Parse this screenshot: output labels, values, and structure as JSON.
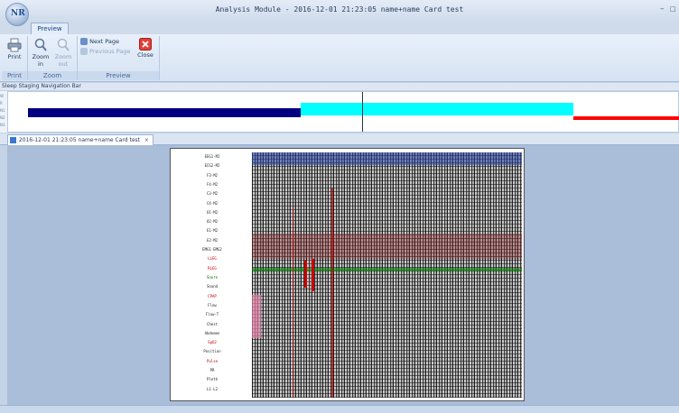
{
  "window": {
    "title": "Analysis Module - 2016-12-01 21:23:05 name+name Card test",
    "app_logo_text": "NR",
    "minimize": "–",
    "restore": "□"
  },
  "ribbon": {
    "active_tab": "Preview",
    "groups": {
      "print": {
        "label": "Print",
        "buttons": {
          "print": "Print"
        }
      },
      "zoom": {
        "label": "Zoom",
        "buttons": {
          "zoom_in": "Zoom in",
          "zoom_out": "Zoom out"
        }
      },
      "preview": {
        "label": "Preview",
        "buttons": {
          "next_page": "Next Page",
          "previous_page": "Previous Page",
          "close": "Close"
        }
      }
    }
  },
  "navigation_bar": {
    "label": "Sleep Staging Navigation Bar",
    "stage_labels": [
      "W",
      "R",
      "N1",
      "N2",
      "N3"
    ],
    "colors": {
      "dark_stage": "#000080",
      "light_stage": "#00ffff",
      "red_stage": "#ff0000"
    }
  },
  "document_tab": {
    "title": "2016-12-01 21:23:05 name+name Card test",
    "close": "×"
  },
  "preview_page": {
    "channels": [
      "EEG1-M2",
      "ECG2-M2",
      "F3-M2",
      "F4-M2",
      "C3-M2",
      "C4-M2",
      "O1-M2",
      "O2-M2",
      "E1-M2",
      "E2-M2",
      "EMG1-EMG2",
      "LLEG",
      "RLEG",
      "Snore",
      "Sound",
      "CPAP",
      "Flow",
      "Flow-T",
      "Chest",
      "Abdomen",
      "SpO2",
      "Position",
      "Pulse",
      "PR",
      "Pleth",
      "L1-L2"
    ]
  }
}
